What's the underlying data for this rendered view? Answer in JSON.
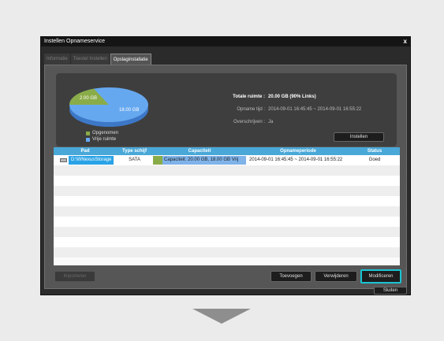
{
  "window": {
    "title": "Instellen  Opnameservice",
    "close_glyph": "x"
  },
  "tabs": [
    {
      "label": "Informatie"
    },
    {
      "label": "Toestel Instellen"
    },
    {
      "label": "Opslaginstallatie"
    }
  ],
  "summary": {
    "pie_used_label": "2.00 GB",
    "pie_free_label": "18.00 GB",
    "used_color": "#8aac48",
    "free_color": "#66a8f0",
    "legend_used": "Opgenomen",
    "legend_free": "Vrije ruimte",
    "total_label": "Totale ruimte :",
    "total_value": "20.00 GB (90% Links)",
    "period_label": "Opname tijd :",
    "period_value": "2014-09-01  16:45:45 ~ 2014-09-01  16:55:22",
    "overwrite_label": "Overschrijven :",
    "overwrite_value": "Ja",
    "setup_button": "Instellen"
  },
  "table": {
    "columns": [
      "Pad",
      "Type schijf",
      "Capaciteit",
      "Opnameperiode",
      "Status"
    ],
    "rows": [
      {
        "path": "D:\\WNexusStorage",
        "type": "SATA",
        "capacity": "Capaciteit: 20.00 GB, 18.00 GB Vrij",
        "period": "2014-09-01  16:45:45 ~  2014-09-01  16:55:22",
        "status": "Goed"
      }
    ]
  },
  "buttons": {
    "import": "Importeren",
    "add": "Toevoegen",
    "remove": "Verwijderen",
    "modify": "Modificeren",
    "close": "Sluiten"
  }
}
